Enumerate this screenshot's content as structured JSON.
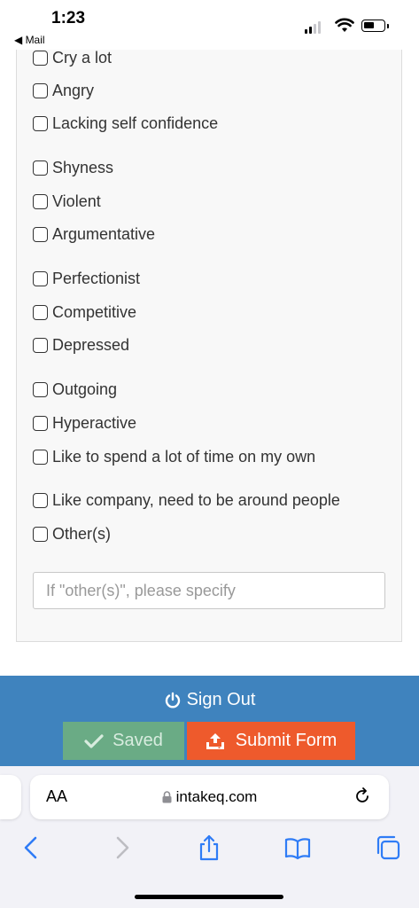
{
  "status_bar": {
    "time": "1:23",
    "back_label": "◀ Mail"
  },
  "options": [
    {
      "label": "Cry a lot",
      "checked": false
    },
    {
      "label": "Angry",
      "checked": false
    },
    {
      "label": "Lacking self confidence",
      "checked": false
    },
    {
      "label": "Shyness",
      "checked": false
    },
    {
      "label": "Violent",
      "checked": false
    },
    {
      "label": "Argumentative",
      "checked": false
    },
    {
      "label": "Perfectionist",
      "checked": false
    },
    {
      "label": "Competitive",
      "checked": false
    },
    {
      "label": "Depressed",
      "checked": false
    },
    {
      "label": "Outgoing",
      "checked": false
    },
    {
      "label": "Hyperactive",
      "checked": false
    },
    {
      "label": "Like to spend a lot of time on my own",
      "checked": false
    },
    {
      "label": "Like company, need to be around people",
      "checked": false
    },
    {
      "label": "Other(s)",
      "checked": false
    }
  ],
  "other_field": {
    "value": "",
    "placeholder": "If \"other(s)\", please specify"
  },
  "actions": {
    "sign_out_label": "Sign Out",
    "saved_label": "Saved",
    "submit_label": "Submit Form"
  },
  "browser": {
    "aa_label": "AA",
    "url": "intakeq.com"
  },
  "icons": {
    "power": "power-icon",
    "check": "checkmark-icon",
    "upload": "upload-icon",
    "lock": "lock-icon",
    "reload": "reload-icon",
    "back": "back-arrow-icon",
    "forward": "forward-arrow-icon",
    "share": "share-icon",
    "bookmarks": "bookmarks-icon",
    "tabs": "tabs-icon"
  },
  "colors": {
    "action_bar": "#3f83be",
    "saved_button": "#6aab85",
    "submit_button": "#ee5a2c",
    "ios_blue": "#2f7cf6"
  }
}
